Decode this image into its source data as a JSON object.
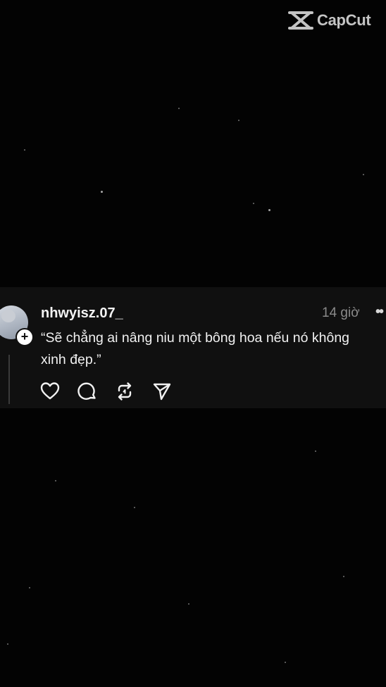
{
  "watermark": {
    "text": "CapCut",
    "icon": "capcut-logo-icon"
  },
  "post": {
    "username": "nhwyisz.07_",
    "time": "14 giờ",
    "text": "“Sẽ chẳng ai nâng niu một bông hoa nếu nó không xinh đẹp.”",
    "avatar_badge": "+",
    "more_icon": "more-dots-icon",
    "actions": [
      "heart-icon",
      "comment-icon",
      "repost-icon",
      "share-icon"
    ]
  },
  "colors": {
    "background": "#030303",
    "post_background": "#101010",
    "text": "#f1f1f1",
    "muted": "#8a8a8a"
  }
}
